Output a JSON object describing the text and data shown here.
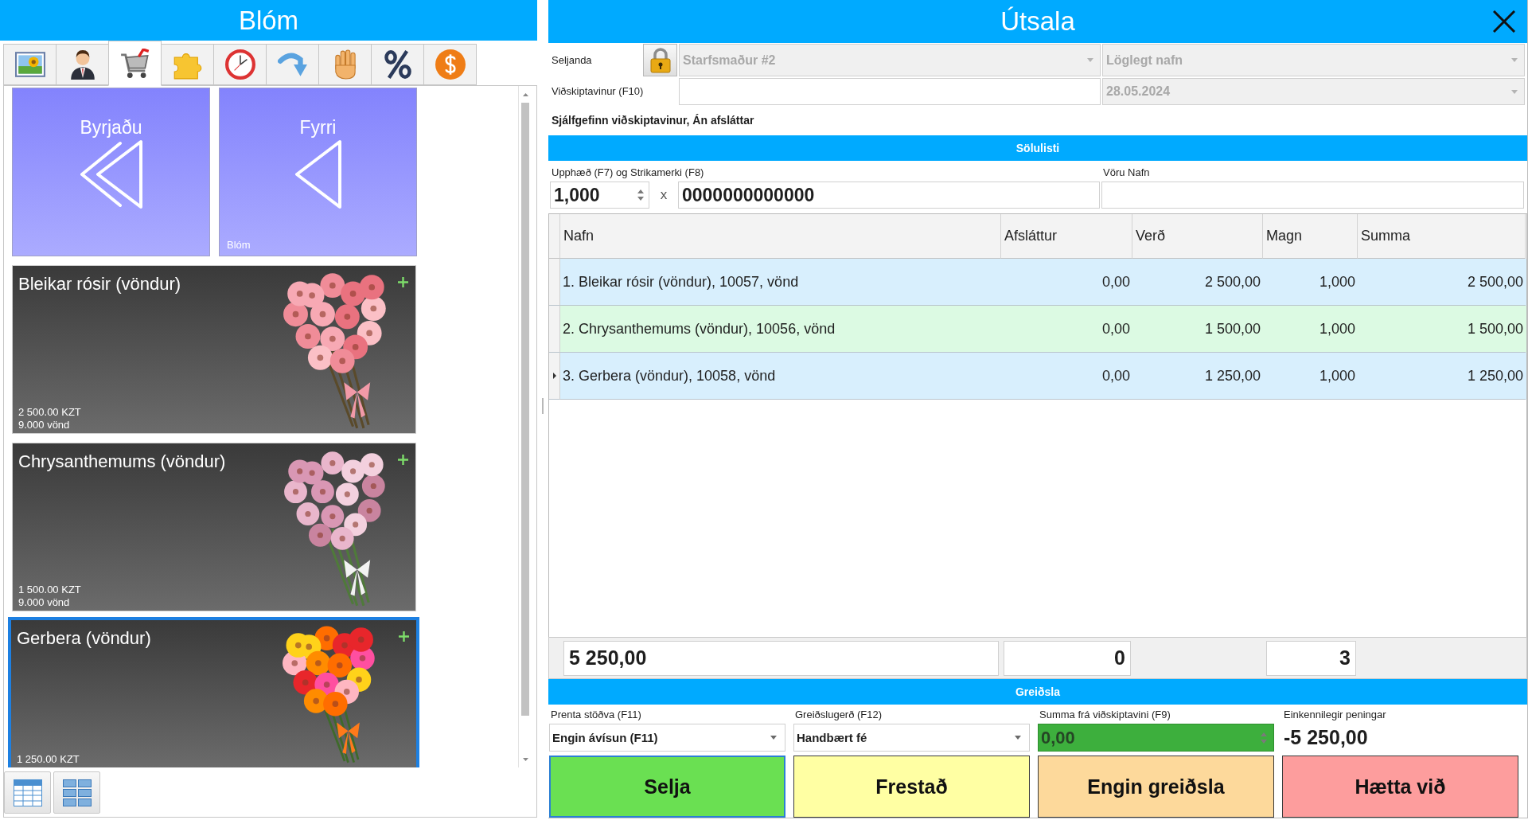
{
  "left_panel": {
    "title": "Blóm",
    "toolbar_tabs": [
      {
        "kind": "picture",
        "selected": false
      },
      {
        "kind": "person",
        "selected": false
      },
      {
        "kind": "cart",
        "selected": true
      },
      {
        "kind": "puzzle",
        "selected": false
      },
      {
        "kind": "clock",
        "selected": false
      },
      {
        "kind": "arrow",
        "selected": false
      },
      {
        "kind": "hand",
        "selected": false
      },
      {
        "kind": "percent",
        "selected": false
      },
      {
        "kind": "coin",
        "selected": false
      }
    ],
    "nav_tiles": [
      {
        "kind": "first",
        "label": "Byrjaðu"
      },
      {
        "kind": "previous",
        "label": "Fyrri",
        "caption": "Blóm"
      }
    ],
    "products": [
      {
        "kind": "roses",
        "name": "Bleikar rósir (vöndur)",
        "price": "2 500.00 KZT",
        "stock": "9.000 vönd",
        "selected": false
      },
      {
        "kind": "chrysanthemums",
        "name": "Chrysanthemums (vöndur)",
        "price": "1 500.00 KZT",
        "stock": "9.000 vönd",
        "selected": false
      },
      {
        "kind": "gerbera",
        "name": "Gerbera (vöndur)",
        "price": "1 250.00 KZT",
        "selected": true
      }
    ],
    "view_buttons": [
      {
        "kind": "table"
      },
      {
        "kind": "tiles"
      }
    ]
  },
  "sale_window": {
    "title": "Útsala",
    "seller": {
      "label": "Seljanda",
      "value": "Starfsmaður #2",
      "disabled": true
    },
    "lock": {
      "locked": true
    },
    "legal_name": {
      "value": "Löglegt nafn",
      "disabled": true
    },
    "customer": {
      "label": "Viðskiptavinur (F10)"
    },
    "date": {
      "value": "28.05.2024",
      "disabled": true
    },
    "customer_info": "Sjálfgefinn viðskiptavinur, Án afsláttar",
    "sales_list": {
      "title": "Sölulisti",
      "entry_label": "Upphæð (F7) og Strikamerki (F8)",
      "quantity": "1,000",
      "times": "x",
      "barcode": "0000000000000",
      "product_name_label": "Vöru Nafn"
    },
    "table": {
      "columns": [
        "Nafn",
        "Afsláttur",
        "Verð",
        "Magn",
        "Summa"
      ],
      "rows": [
        {
          "cells": [
            "1. Bleikar rósir (vöndur), 10057, vönd",
            "0,00",
            "2 500,00",
            "1,000",
            "2 500,00"
          ],
          "current": false
        },
        {
          "cells": [
            "2. Chrysanthemums (vöndur), 10056, vönd",
            "0,00",
            "1 500,00",
            "1,000",
            "1 500,00"
          ],
          "current": false
        },
        {
          "cells": [
            "3. Gerbera (vöndur), 10058, vönd",
            "0,00",
            "1 250,00",
            "1,000",
            "1 250,00"
          ],
          "current": true
        }
      ]
    },
    "totals": {
      "amount": "5 250,00",
      "discount": "0",
      "count": "3"
    },
    "payment": {
      "title": "Greiðsla",
      "fields": [
        {
          "kind": "dropdown",
          "label": "Prenta stöðva (F11)",
          "value": "Engin ávísun (F11)"
        },
        {
          "kind": "dropdown",
          "label": "Greiðslugerð (F12)",
          "value": "Handbært fé"
        },
        {
          "kind": "spinner",
          "label": "Summa frá viðskiptavini (F9)",
          "value": "0,00"
        },
        {
          "kind": "readout",
          "label": "Einkennilegir peningar",
          "value": "-5 250,00"
        }
      ],
      "buttons": [
        {
          "label": "Selja",
          "color": "#6ae052",
          "focused": true
        },
        {
          "label": "Frestað",
          "color": "#ffffa3",
          "focused": false
        },
        {
          "label": "Engin greiðsla",
          "color": "#fdd99b",
          "focused": false
        },
        {
          "label": "Hætta við",
          "color": "#fd9d9d",
          "focused": false
        }
      ]
    }
  }
}
